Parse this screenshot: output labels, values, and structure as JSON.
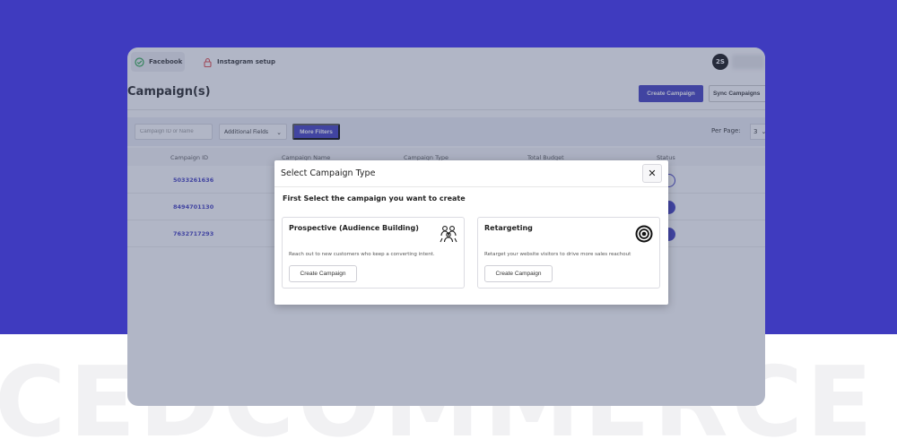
{
  "watermark": "CEDCOMMERCE",
  "topbar": {
    "tabs": [
      {
        "label": "Facebook",
        "icon": "check-circle-icon"
      },
      {
        "label": "Instagram  setup",
        "icon": "lock-icon"
      }
    ],
    "avatar_initials": "2S"
  },
  "page": {
    "title": "Campaign(s)",
    "create_button": "Create Campaign",
    "sync_button": "Sync Campaigns"
  },
  "filters": {
    "search_placeholder": "Campaign ID or Name",
    "additional_fields": "Additional Fields",
    "more_filters": "More Filters",
    "per_page_label": "Per Page:",
    "per_page_value": "3"
  },
  "table": {
    "columns": [
      "Campaign ID",
      "Campaign Name",
      "Campaign Type",
      "Total Budget",
      "Status"
    ],
    "rows": [
      {
        "campaign_id": "5033261636",
        "status_on": false
      },
      {
        "campaign_id": "8494701130",
        "status_on": true
      },
      {
        "campaign_id": "7632717293",
        "status_on": true
      }
    ]
  },
  "modal": {
    "title": "Select Campaign Type",
    "subtitle": "First Select the campaign you want to create",
    "close_icon": "close-icon",
    "cards": [
      {
        "title": "Prospective (Audience Building)",
        "description": "Reach out to new customers who keep a converting intent.",
        "button": "Create Campaign",
        "icon": "audience-icon"
      },
      {
        "title": "Retargeting",
        "description": "Retarget your website visitors to drive more sales reachout",
        "button": "Create Campaign",
        "icon": "target-icon"
      }
    ]
  },
  "colors": {
    "brand": "#3f3bbf",
    "background_top": "#3f3bbf",
    "overlay": "rgba(70,80,120,0.42)"
  }
}
